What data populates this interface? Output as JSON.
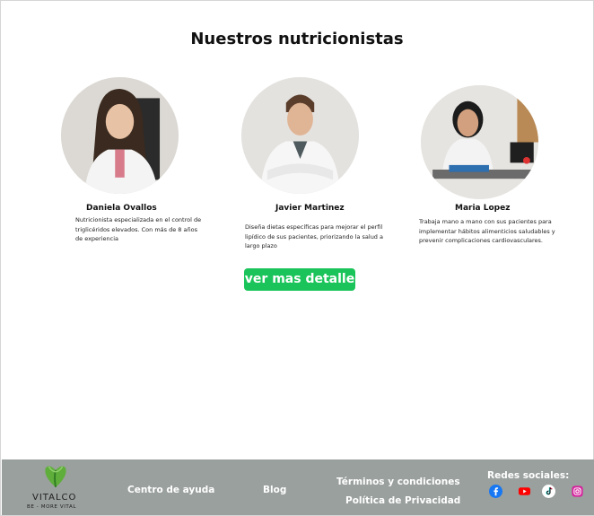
{
  "section": {
    "title": "Nuestros nutricionistas"
  },
  "nutritionists": [
    {
      "name": "Daniela Ovallos",
      "description": "Nutricionista especializada en el control de triglicéridos elevados. Con más de 8 años de experiencia"
    },
    {
      "name": "Javier Martinez",
      "description": "Diseña dietas específicas para mejorar el perfil lipídico de sus pacientes, priorizando la salud a largo plazo"
    },
    {
      "name": "Maria Lopez",
      "description": "Trabaja mano a mano con sus pacientes para implementar hábitos alimenticios saludables y prevenir complicaciones cardiovasculares."
    }
  ],
  "cta": {
    "label": "ver mas detalle"
  },
  "footer": {
    "brand": "VITALCO",
    "tagline": "BE - MORE VITAL",
    "links": {
      "help": "Centro de ayuda",
      "blog": "Blog",
      "terms": "Términos y condiciones",
      "privacy": "Política de Privacidad"
    },
    "social_title": "Redes sociales:",
    "social_icons": [
      "facebook-icon",
      "youtube-icon",
      "tiktok-icon",
      "instagram-icon"
    ]
  },
  "colors": {
    "cta_green": "#1bc45a",
    "footer_bg": "#9aa09d",
    "brand_green": "#5fae3c"
  }
}
